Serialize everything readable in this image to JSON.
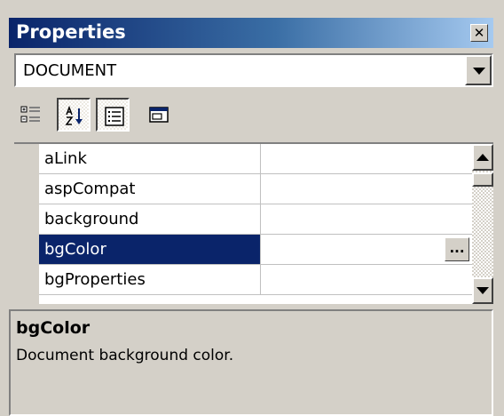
{
  "window": {
    "title": "Properties",
    "close_label": "✕"
  },
  "object_selector": {
    "value": "DOCUMENT"
  },
  "toolbar": {
    "buttons": [
      {
        "icon": "categorized-icon",
        "pressed": false
      },
      {
        "icon": "alphabetical-sort-icon",
        "pressed": true
      },
      {
        "icon": "properties-icon",
        "pressed": true
      },
      {
        "icon": "property-pages-icon",
        "pressed": false
      }
    ]
  },
  "properties": [
    {
      "name": "aLink",
      "value": ""
    },
    {
      "name": "aspCompat",
      "value": ""
    },
    {
      "name": "background",
      "value": ""
    },
    {
      "name": "bgColor",
      "value": "",
      "selected": true
    },
    {
      "name": "bgProperties",
      "value": ""
    }
  ],
  "ellipsis_label": "...",
  "description": {
    "title": "bgColor",
    "text": "Document background color."
  },
  "colors": {
    "title_start": "#0a246a",
    "title_end": "#a6caf0",
    "selection": "#0a246a",
    "face": "#d4d0c8"
  }
}
